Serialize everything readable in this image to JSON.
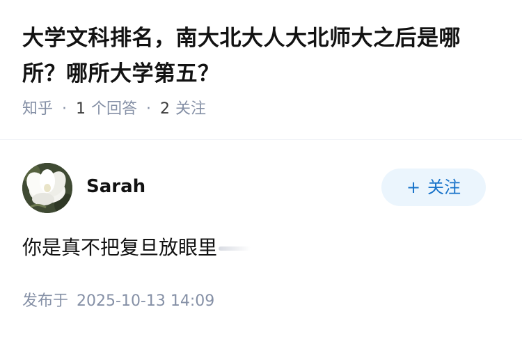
{
  "question": {
    "title": "大学文科排名，南大北大人大北师大之后是哪所？哪所大学第五？",
    "source": "知乎",
    "separator": "·",
    "answer_count": "1",
    "answer_label": "个回答",
    "follower_count": "2",
    "follower_label": "关注"
  },
  "answer": {
    "author_name": "Sarah",
    "follow_button": {
      "plus": "+",
      "label": "关注"
    },
    "content": "你是真不把复旦放眼里",
    "published_label": "发布于",
    "published_time": "2025-10-13 14:09"
  },
  "colors": {
    "meta_gray": "#8590a6",
    "follow_bg": "#ebf5fd",
    "follow_text": "#1772c9"
  },
  "icons": {
    "avatar": "white-flower-avatar"
  }
}
